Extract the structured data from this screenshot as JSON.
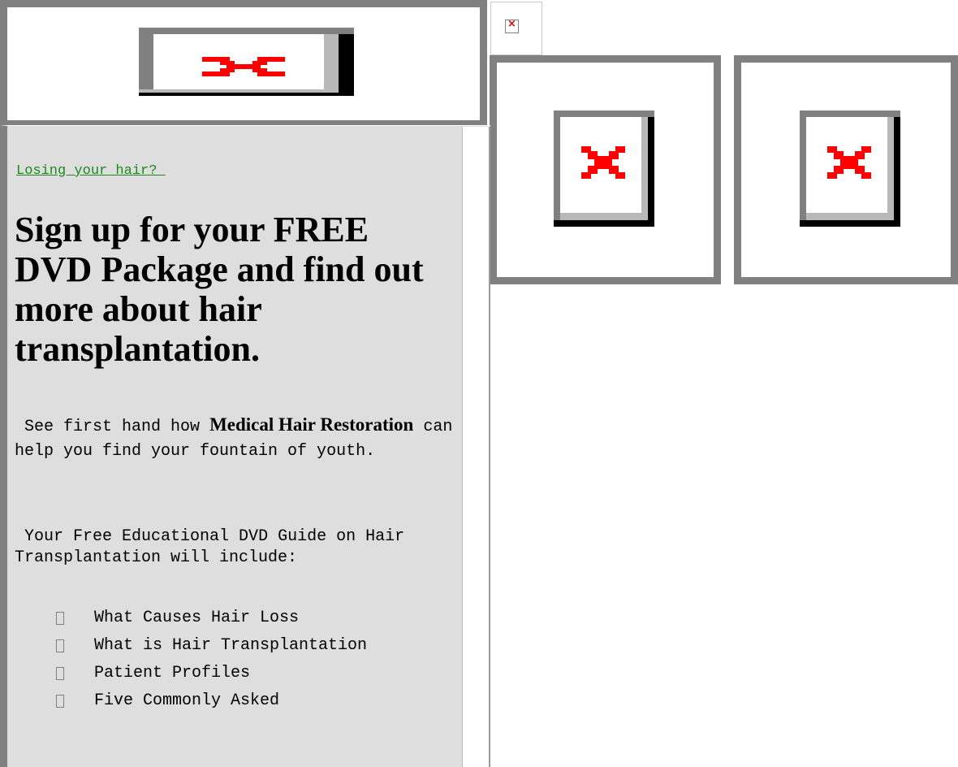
{
  "link": {
    "text": "Losing your hair? "
  },
  "headline": "Sign up for your FREE DVD Package and find out more about hair transplantation.",
  "para1": {
    "prefix": " See first hand how ",
    "bold": "Medical Hair Restoration",
    "suffix": " can help you find your fountain of youth."
  },
  "para2": " Your Free Educational DVD Guide on Hair Transplantation will include:",
  "list": [
    " What Causes Hair Loss",
    "What is Hair Transplantation",
    "Patient Profiles",
    "Five Commonly Asked"
  ],
  "icons": {
    "broken": "broken-image-icon"
  },
  "colors": {
    "frame_gray": "#808080",
    "panel_bg": "#dedede",
    "link_green": "#1a8a1a",
    "broken_red": "#e00000"
  }
}
